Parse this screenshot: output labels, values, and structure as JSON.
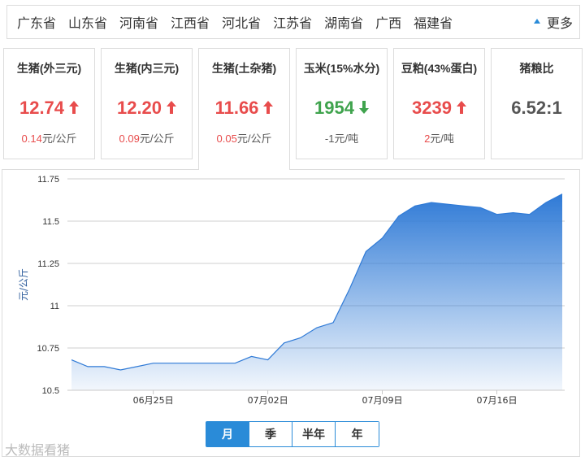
{
  "provinces": {
    "items": [
      "广东省",
      "山东省",
      "河南省",
      "江西省",
      "河北省",
      "江苏省",
      "湖南省",
      "广西",
      "福建省"
    ],
    "more_label": "更多"
  },
  "cards": [
    {
      "title": "生猪(外三元)",
      "value": "12.74",
      "direction": "up",
      "change": "0.14",
      "unit": "元/公斤"
    },
    {
      "title": "生猪(内三元)",
      "value": "12.20",
      "direction": "up",
      "change": "0.09",
      "unit": "元/公斤"
    },
    {
      "title": "生猪(土杂猪)",
      "value": "11.66",
      "direction": "up",
      "change": "0.05",
      "unit": "元/公斤"
    },
    {
      "title": "玉米(15%水分)",
      "value": "1954",
      "direction": "down",
      "change": "-1",
      "unit": "元/吨"
    },
    {
      "title": "豆粕(43%蛋白)",
      "value": "3239",
      "direction": "up",
      "change": "2",
      "unit": "元/吨"
    },
    {
      "title": "猪粮比",
      "value": "6.52:1",
      "direction": "none",
      "change": "",
      "unit": ""
    }
  ],
  "active_card": 2,
  "range_tabs": [
    "月",
    "季",
    "半年",
    "年"
  ],
  "active_range": 0,
  "watermark": "大数据看猪",
  "colors": {
    "up": "#e84c4c",
    "down": "#3fa34d",
    "accent": "#2a8bd8",
    "line": "#2f7ad6"
  },
  "chart_data": {
    "type": "area",
    "title": "",
    "xlabel": "",
    "ylabel": "元/公斤",
    "ylim": [
      10.5,
      11.75
    ],
    "yticks": [
      "10.5",
      "10.75",
      "11",
      "11.25",
      "11.5",
      "11.75"
    ],
    "xticks": [
      {
        "label": "06月25日",
        "index": 5
      },
      {
        "label": "07月02日",
        "index": 12
      },
      {
        "label": "07月09日",
        "index": 19
      },
      {
        "label": "07月16日",
        "index": 26
      }
    ],
    "grid": true,
    "series": [
      {
        "values": [
          10.68,
          10.64,
          10.64,
          10.62,
          10.64,
          10.66,
          10.66,
          10.66,
          10.66,
          10.66,
          10.66,
          10.7,
          10.68,
          10.78,
          10.81,
          10.87,
          10.9,
          11.1,
          11.32,
          11.4,
          11.53,
          11.59,
          11.61,
          11.6,
          11.59,
          11.58,
          11.54,
          11.55,
          11.54,
          11.61,
          11.66
        ]
      }
    ]
  }
}
